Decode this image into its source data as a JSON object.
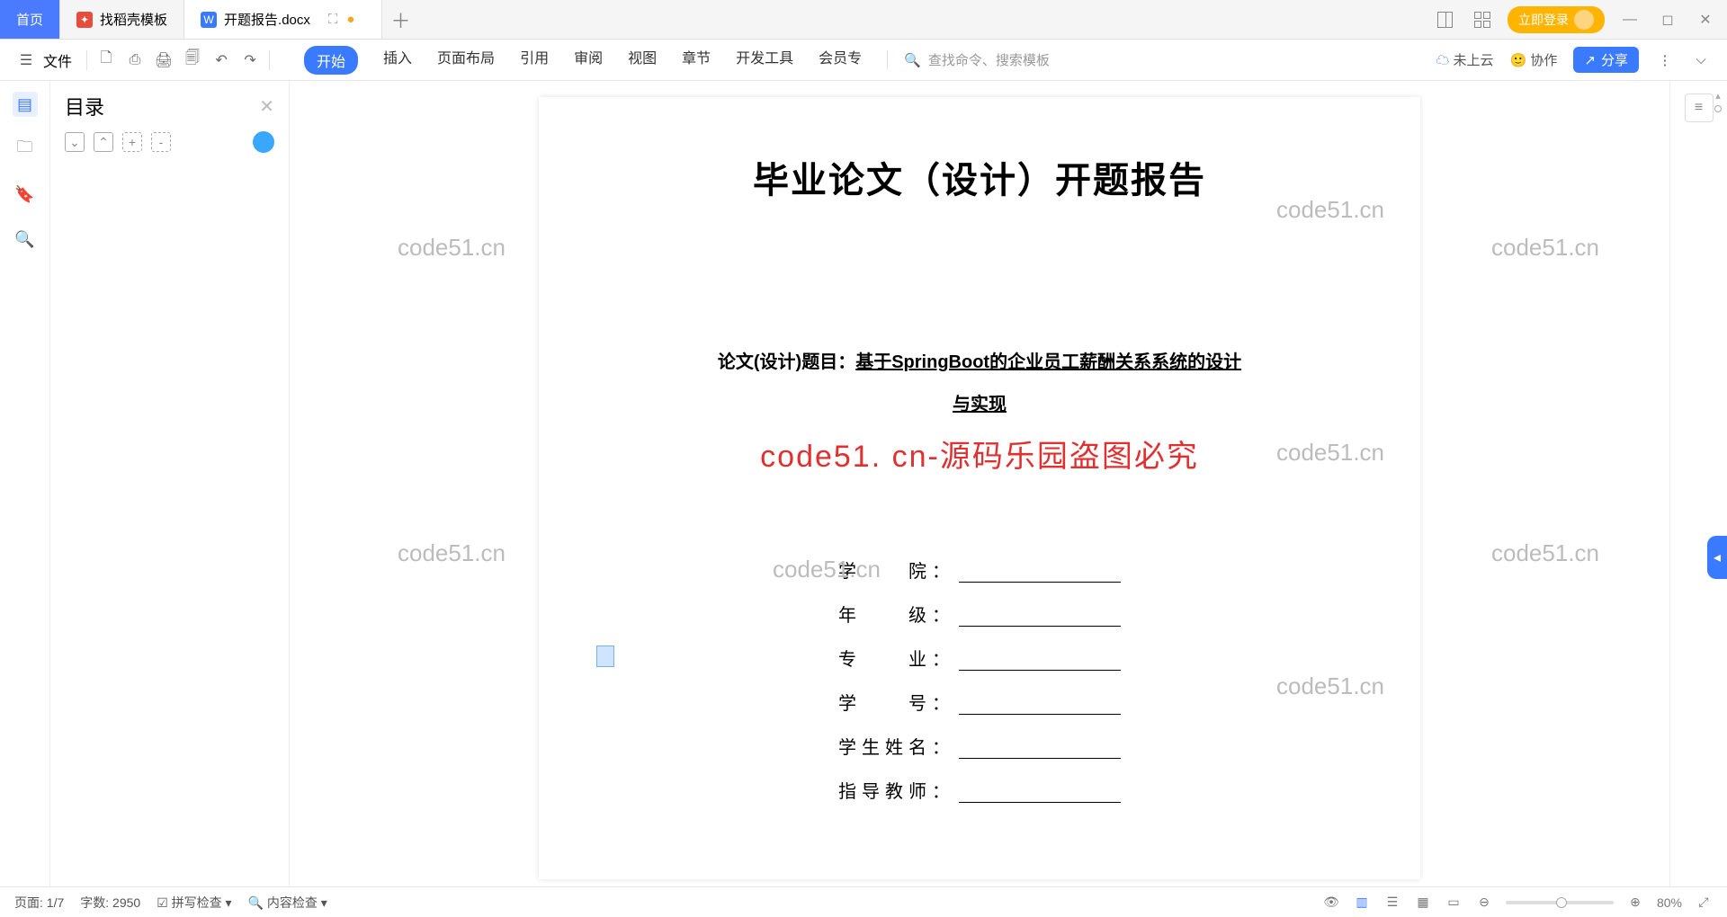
{
  "tabs": {
    "home": "首页",
    "t1": "找稻壳模板",
    "t2": "开题报告.docx"
  },
  "titlebar": {
    "login": "立即登录"
  },
  "ribbon": {
    "file": "文件",
    "menus": [
      "开始",
      "插入",
      "页面布局",
      "引用",
      "审阅",
      "视图",
      "章节",
      "开发工具",
      "会员专"
    ],
    "search_ph": "查找命令、搜索模板",
    "cloud": "未上云",
    "collab": "协作",
    "share": "分享"
  },
  "outline": {
    "title": "目录"
  },
  "doc": {
    "title": "毕业论文（设计）开题报告",
    "topic_label": "论文(设计)题目：",
    "topic_value": "基于SpringBoot的企业员工薪酬关系系统的设计",
    "topic_line2": "与实现",
    "red_watermark": "code51. cn-源码乐园盗图必究",
    "fields": [
      "学　　院：",
      "年　　级：",
      "专　　业：",
      "学　　号：",
      "学生姓名：",
      "指导教师："
    ]
  },
  "watermarks": [
    "code51.cn",
    "code51.cn",
    "code51.cn",
    "code51.cn",
    "code51.cn",
    "code51.cn",
    "code51.cn",
    "code51.cn",
    "code51.cn",
    "code51.cn"
  ],
  "status": {
    "page": "页面: 1/7",
    "words": "字数: 2950",
    "spell": "拼写检查",
    "content": "内容检查",
    "zoom": "80%"
  }
}
